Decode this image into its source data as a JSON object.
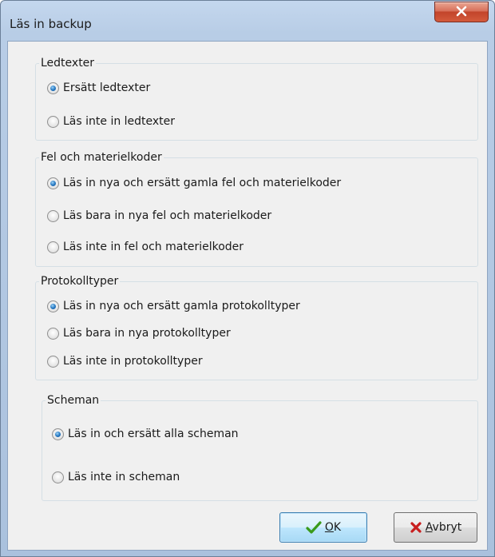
{
  "window": {
    "title": "Läs in backup"
  },
  "icons": {
    "close": "close-x-icon",
    "ok": "green-checkmark-icon",
    "cancel": "red-x-icon"
  },
  "groups": [
    {
      "label": "Ledtexter",
      "options": [
        {
          "label": "Ersätt ledtexter",
          "checked": true
        },
        {
          "label": "Läs inte in ledtexter",
          "checked": false
        }
      ]
    },
    {
      "label": "Fel och materielkoder",
      "options": [
        {
          "label": "Läs in nya och ersätt gamla fel och materielkoder",
          "checked": true
        },
        {
          "label": "Läs bara in nya fel och materielkoder",
          "checked": false
        },
        {
          "label": "Läs inte in fel och materielkoder",
          "checked": false
        }
      ]
    },
    {
      "label": "Protokolltyper",
      "options": [
        {
          "label": "Läs in nya och ersätt gamla protokolltyper",
          "checked": true
        },
        {
          "label": "Läs bara in nya protokolltyper",
          "checked": false
        },
        {
          "label": "Läs inte in protokolltyper",
          "checked": false
        }
      ]
    },
    {
      "label": "Scheman",
      "options": [
        {
          "label": "Läs in och ersätt alla scheman",
          "checked": true
        },
        {
          "label": "Läs inte in scheman",
          "checked": false
        }
      ]
    }
  ],
  "buttons": {
    "ok": {
      "first": "O",
      "rest": "K"
    },
    "cancel": {
      "first": "A",
      "rest": "vbryt"
    }
  },
  "colors": {
    "radio_selected": "#2a7cc4",
    "close_button": "#c2442a",
    "ok_check": "#3a9a1a",
    "cancel_x": "#c81e1e"
  }
}
